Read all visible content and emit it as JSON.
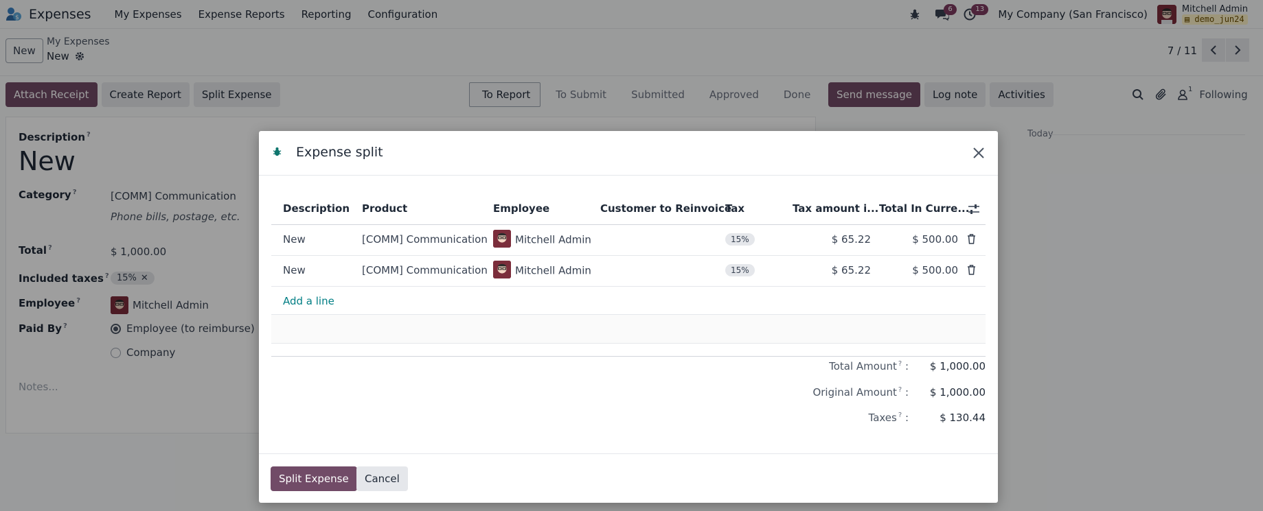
{
  "navbar": {
    "app_name": "Expenses",
    "menu": [
      "My Expenses",
      "Expense Reports",
      "Reporting",
      "Configuration"
    ],
    "chat_count": "6",
    "activity_count": "13",
    "company": "My Company (San Francisco)",
    "user_name": "Mitchell Admin",
    "db_name": "demo_jun24"
  },
  "control_panel": {
    "new_label": "New",
    "breadcrumb_parent": "My Expenses",
    "breadcrumb_current": "New",
    "pager": "7 / 11"
  },
  "actions": {
    "attach_receipt": "Attach Receipt",
    "create_report": "Create Report",
    "split_expense": "Split Expense"
  },
  "status": {
    "stages": [
      "To Report",
      "To Submit",
      "Submitted",
      "Approved",
      "Done"
    ],
    "active": "To Report"
  },
  "chatter": {
    "send_message": "Send message",
    "log_note": "Log note",
    "activities": "Activities",
    "follower_count": "1",
    "following": "Following",
    "today": "Today"
  },
  "form": {
    "description_label": "Description",
    "description_value": "New",
    "category_label": "Category",
    "category_value": "[COMM] Communication",
    "category_hint": "Phone bills, postage, etc.",
    "total_label": "Total",
    "total_value": "$ 1,000.00",
    "taxes_label": "Included taxes",
    "tax_chip": "15%",
    "employee_label": "Employee",
    "employee_value": "Mitchell Admin",
    "paid_by_label": "Paid By",
    "paid_by_options": [
      "Employee (to reimburse)",
      "Company"
    ],
    "notes_placeholder": "Notes...",
    "sup": "?"
  },
  "modal": {
    "title": "Expense split",
    "columns": [
      "Description",
      "Product",
      "Employee",
      "Customer to Reinvoice",
      "Tax",
      "Tax amount i...",
      "Total In Curre..."
    ],
    "rows": [
      {
        "description": "New",
        "product": "[COMM] Communication",
        "employee": "Mitchell Admin",
        "customer": "",
        "tax": "15%",
        "tax_amount": "$ 65.22",
        "total": "$ 500.00"
      },
      {
        "description": "New",
        "product": "[COMM] Communication",
        "employee": "Mitchell Admin",
        "customer": "",
        "tax": "15%",
        "tax_amount": "$ 65.22",
        "total": "$ 500.00"
      }
    ],
    "add_line": "Add a line",
    "totals": [
      {
        "label": "Total Amount",
        "value": "$ 1,000.00"
      },
      {
        "label": "Original Amount",
        "value": "$ 1,000.00"
      },
      {
        "label": "Taxes",
        "value": "$ 130.44"
      }
    ],
    "split_button": "Split Expense",
    "cancel_button": "Cancel"
  },
  "colors": {
    "primary": "#714b67",
    "link": "#017e84",
    "badge": "#7d3b5f"
  }
}
